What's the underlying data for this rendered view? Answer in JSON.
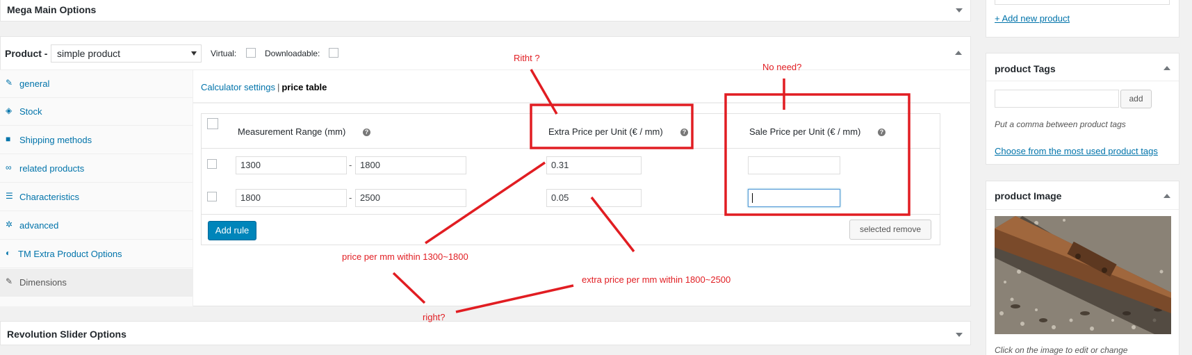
{
  "mega_main": {
    "title": "Mega Main Options"
  },
  "product_box": {
    "label": "Product -",
    "type_select": "simple product",
    "virtual_label": "Virtual:",
    "downloadable_label": "Downloadable:"
  },
  "tabs": [
    {
      "label": "general",
      "icon": "wrench-icon"
    },
    {
      "label": "Stock",
      "icon": "tag-icon"
    },
    {
      "label": "Shipping methods",
      "icon": "truck-icon"
    },
    {
      "label": "related products",
      "icon": "link-icon"
    },
    {
      "label": "Characteristics",
      "icon": "list-icon"
    },
    {
      "label": "advanced",
      "icon": "gear-icon"
    },
    {
      "label": "TM Extra Product Options",
      "icon": "half-circle-icon"
    },
    {
      "label": "Dimensions",
      "icon": "wrench-icon"
    }
  ],
  "subtabs": {
    "settings": "Calculator settings",
    "separator": "|",
    "current": "price table"
  },
  "table": {
    "headers": {
      "range": "Measurement Range (mm)",
      "extra": "Extra Price per Unit (€ / mm)",
      "sale": "Sale Price per Unit (€ / mm)"
    },
    "help_glyph": "?",
    "dash": "-",
    "rows": [
      {
        "from": "1300",
        "to": "1800",
        "extra": "0.31",
        "sale": ""
      },
      {
        "from": "1800",
        "to": "2500",
        "extra": "0.05",
        "sale": ""
      }
    ],
    "add_rule": "Add rule",
    "remove": "selected remove"
  },
  "revolution": {
    "title": "Revolution Slider Options"
  },
  "sidebar": {
    "add_new_product": "+ Add new product",
    "tags_title": "product Tags",
    "tags_add": "add",
    "tags_hint": "Put a comma between product tags",
    "tags_choose": "Choose from the most used product tags",
    "image_title": "product Image",
    "image_hint": "Click on the image to edit or change"
  },
  "annotations": {
    "riht": "Ritht ?",
    "no_need": "No need?",
    "price_per_mm": "price per mm within 1300~1800",
    "extra_price_per_mm": "extra price per mm within 1800~2500",
    "right": "right?"
  },
  "colors": {
    "annotation_red": "#e11d22",
    "primary_button": "#0085ba",
    "link": "#0073aa"
  }
}
